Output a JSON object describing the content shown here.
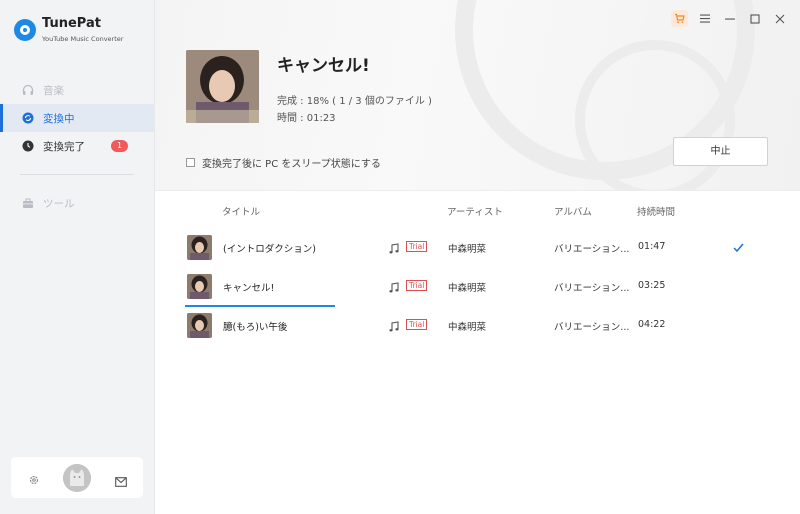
{
  "brand": {
    "name": "TunePat",
    "subtitle": "YouTube Music Converter"
  },
  "sidebar": {
    "items": [
      {
        "label": "音楽",
        "icon": "headphones-icon",
        "state": "disabled"
      },
      {
        "label": "変換中",
        "icon": "converting-icon",
        "state": "active"
      },
      {
        "label": "変換完了",
        "icon": "clock-icon",
        "state": "normal",
        "badge": "1"
      },
      {
        "label": "ツール",
        "icon": "toolbox-icon",
        "state": "disabled"
      }
    ]
  },
  "now_converting": {
    "title": "キャンセル!",
    "progress": "完成 : 18% ( 1 / 3 個のファイル )",
    "time": "時間 : 01:23",
    "sleep_option": "変換完了後に PC をスリープ状態にする",
    "stop_label": "中止"
  },
  "table": {
    "headers": {
      "title": "タイトル",
      "artist": "アーティスト",
      "album": "アルバム",
      "duration": "持続時間"
    },
    "rows": [
      {
        "title": "(イントロダクション)",
        "trial": "Trial",
        "artist": "中森明菜",
        "album": "バリエーション...",
        "duration": "01:47",
        "status": "done"
      },
      {
        "title": "キャンセル!",
        "trial": "Trial",
        "artist": "中森明菜",
        "album": "バリエーション...",
        "duration": "03:25",
        "status": "converting",
        "progress": 0.18
      },
      {
        "title": "臆(もろ)い午後",
        "trial": "Trial",
        "artist": "中森明菜",
        "album": "バリエーション...",
        "duration": "04:22",
        "status": "waiting"
      }
    ]
  },
  "colors": {
    "accent": "#1e6fd9",
    "badge": "#f05a5a",
    "trial": "#e05050"
  }
}
